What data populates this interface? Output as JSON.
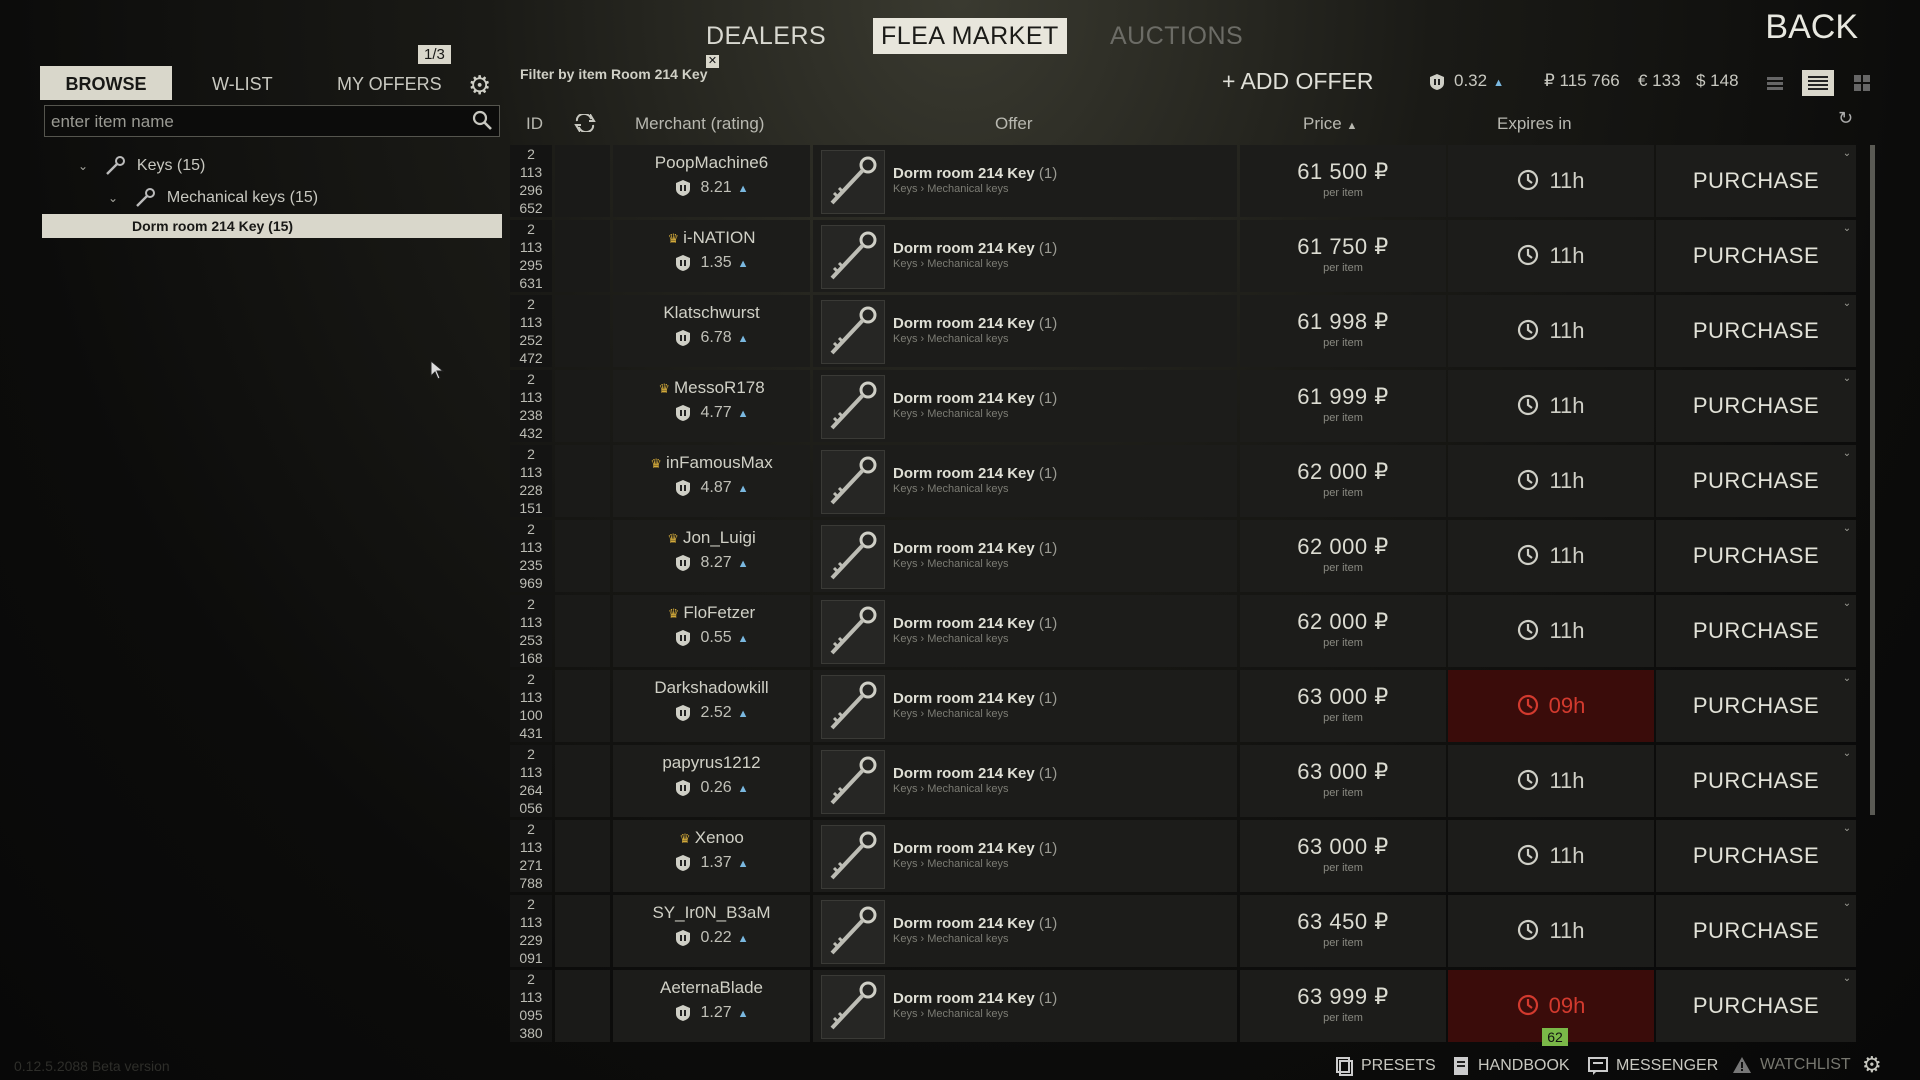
{
  "topnav": {
    "dealers": "DEALERS",
    "flea": "FLEA MARKET",
    "auctions": "AUCTIONS",
    "back": "BACK"
  },
  "left": {
    "tabs": {
      "browse": "BROWSE",
      "wlist": "W-LIST",
      "myoffers": "MY OFFERS"
    },
    "offer_counter": "1/3",
    "search_placeholder": "enter item name",
    "tree": {
      "keys": "Keys (15)",
      "mech": "Mechanical keys (15)",
      "item": "Dorm room 214 Key (15)"
    }
  },
  "filter": {
    "label": "Filter by item Room 214 Key",
    "close": "✕"
  },
  "toolbar": {
    "add_offer": "+ ADD OFFER",
    "rep": "0.32",
    "rub": "₽ 115 766",
    "eur": "€ 133",
    "usd": "$ 148"
  },
  "header": {
    "id": "ID",
    "merchant": "Merchant (rating)",
    "offer": "Offer",
    "price": "Price",
    "expires": "Expires in"
  },
  "common": {
    "item_name": "Dorm room 214 Key",
    "qty": "(1)",
    "category": "Keys › Mechanical keys",
    "per_item": "per item",
    "purchase": "PURCHASE"
  },
  "rows": [
    {
      "id": [
        "2",
        "113",
        "296",
        "652"
      ],
      "merchant": "PoopMachine6",
      "crown": false,
      "rating": "8.21",
      "price": "61 500",
      "expires": "11h",
      "warn": false
    },
    {
      "id": [
        "2",
        "113",
        "295",
        "631"
      ],
      "merchant": "i-NATION",
      "crown": true,
      "rating": "1.35",
      "price": "61 750",
      "expires": "11h",
      "warn": false
    },
    {
      "id": [
        "2",
        "113",
        "252",
        "472"
      ],
      "merchant": "Klatschwurst",
      "crown": false,
      "rating": "6.78",
      "price": "61 998",
      "expires": "11h",
      "warn": false
    },
    {
      "id": [
        "2",
        "113",
        "238",
        "432"
      ],
      "merchant": "MessoR178",
      "crown": true,
      "rating": "4.77",
      "price": "61 999",
      "expires": "11h",
      "warn": false
    },
    {
      "id": [
        "2",
        "113",
        "228",
        "151"
      ],
      "merchant": "inFamousMax",
      "crown": true,
      "rating": "4.87",
      "price": "62 000",
      "expires": "11h",
      "warn": false
    },
    {
      "id": [
        "2",
        "113",
        "235",
        "969"
      ],
      "merchant": "Jon_Luigi",
      "crown": true,
      "rating": "8.27",
      "price": "62 000",
      "expires": "11h",
      "warn": false
    },
    {
      "id": [
        "2",
        "113",
        "253",
        "168"
      ],
      "merchant": "FloFetzer",
      "crown": true,
      "rating": "0.55",
      "price": "62 000",
      "expires": "11h",
      "warn": false
    },
    {
      "id": [
        "2",
        "113",
        "100",
        "431"
      ],
      "merchant": "Darkshadowkill",
      "crown": false,
      "rating": "2.52",
      "price": "63 000",
      "expires": "09h",
      "warn": true
    },
    {
      "id": [
        "2",
        "113",
        "264",
        "056"
      ],
      "merchant": "papyrus1212",
      "crown": false,
      "rating": "0.26",
      "price": "63 000",
      "expires": "11h",
      "warn": false
    },
    {
      "id": [
        "2",
        "113",
        "271",
        "788"
      ],
      "merchant": "Xenoo",
      "crown": true,
      "rating": "1.37",
      "price": "63 000",
      "expires": "11h",
      "warn": false
    },
    {
      "id": [
        "2",
        "113",
        "229",
        "091"
      ],
      "merchant": "SY_Ir0N_B3aM",
      "crown": false,
      "rating": "0.22",
      "price": "63 450",
      "expires": "11h",
      "warn": false
    },
    {
      "id": [
        "2",
        "113",
        "095",
        "380"
      ],
      "merchant": "AeternaBlade",
      "crown": false,
      "rating": "1.27",
      "price": "63 999",
      "expires": "09h",
      "warn": true
    }
  ],
  "badge": "62",
  "footer": {
    "version": "0.12.5.2088 Beta version",
    "presets": "PRESETS",
    "handbook": "HANDBOOK",
    "messenger": "MESSENGER",
    "watchlist": "WATCHLIST"
  }
}
